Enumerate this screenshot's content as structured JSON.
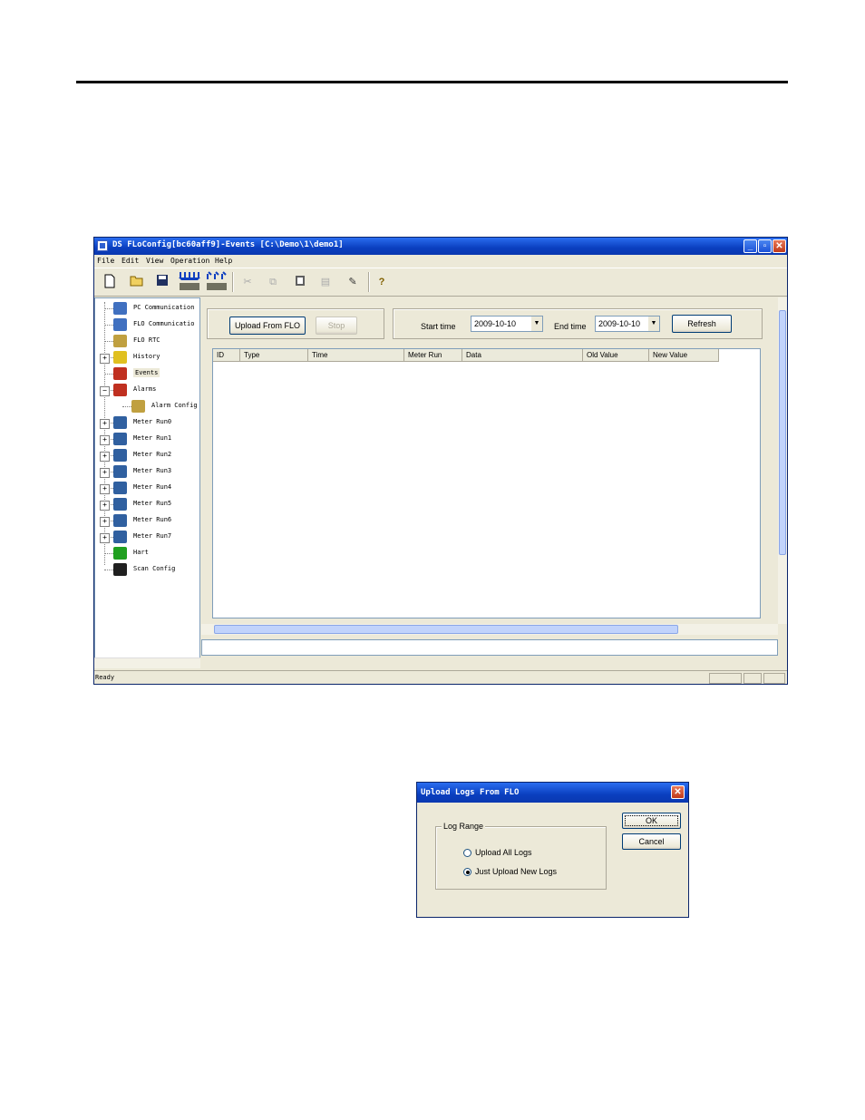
{
  "window": {
    "title": "DS FLoConfig[bc60aff9]-Events [C:\\Demo\\1\\demo1]",
    "minimize": "_",
    "maximize": "▫",
    "close": "✕"
  },
  "menu": [
    "File",
    "Edit",
    "View",
    "Operation",
    "Help"
  ],
  "tree": {
    "items": [
      {
        "label": "PC Communication"
      },
      {
        "label": "FLO Communicatio"
      },
      {
        "label": "FLO RTC"
      },
      {
        "label": "History",
        "expander": "+"
      },
      {
        "label": "Events"
      },
      {
        "label": "Alarms",
        "expander": "−"
      },
      {
        "label": "Alarm Config"
      },
      {
        "label": "Meter Run0",
        "expander": "+"
      },
      {
        "label": "Meter Run1",
        "expander": "+"
      },
      {
        "label": "Meter Run2",
        "expander": "+"
      },
      {
        "label": "Meter Run3",
        "expander": "+"
      },
      {
        "label": "Meter Run4",
        "expander": "+"
      },
      {
        "label": "Meter Run5",
        "expander": "+"
      },
      {
        "label": "Meter Run6",
        "expander": "+"
      },
      {
        "label": "Meter Run7",
        "expander": "+"
      },
      {
        "label": "Hart"
      },
      {
        "label": "Scan Config"
      }
    ]
  },
  "events_panel": {
    "upload_button": "Upload From FLO",
    "stop_button": "Stop",
    "start_time_label": "Start time",
    "start_time_value": "2009-10-10",
    "end_time_label": "End time",
    "end_time_value": "2009-10-10",
    "refresh_button": "Refresh",
    "columns": [
      "ID",
      "Type",
      "Time",
      "Meter Run",
      "Data",
      "Old Value",
      "New Value"
    ]
  },
  "status": {
    "text": "Ready"
  },
  "dialog": {
    "title": "Upload Logs From FLO",
    "close": "✕",
    "group_label": "Log Range",
    "options": [
      {
        "label": "Upload All Logs",
        "checked": false
      },
      {
        "label": "Just Upload New Logs",
        "checked": true
      }
    ],
    "ok_button": "OK",
    "cancel_button": "Cancel"
  }
}
